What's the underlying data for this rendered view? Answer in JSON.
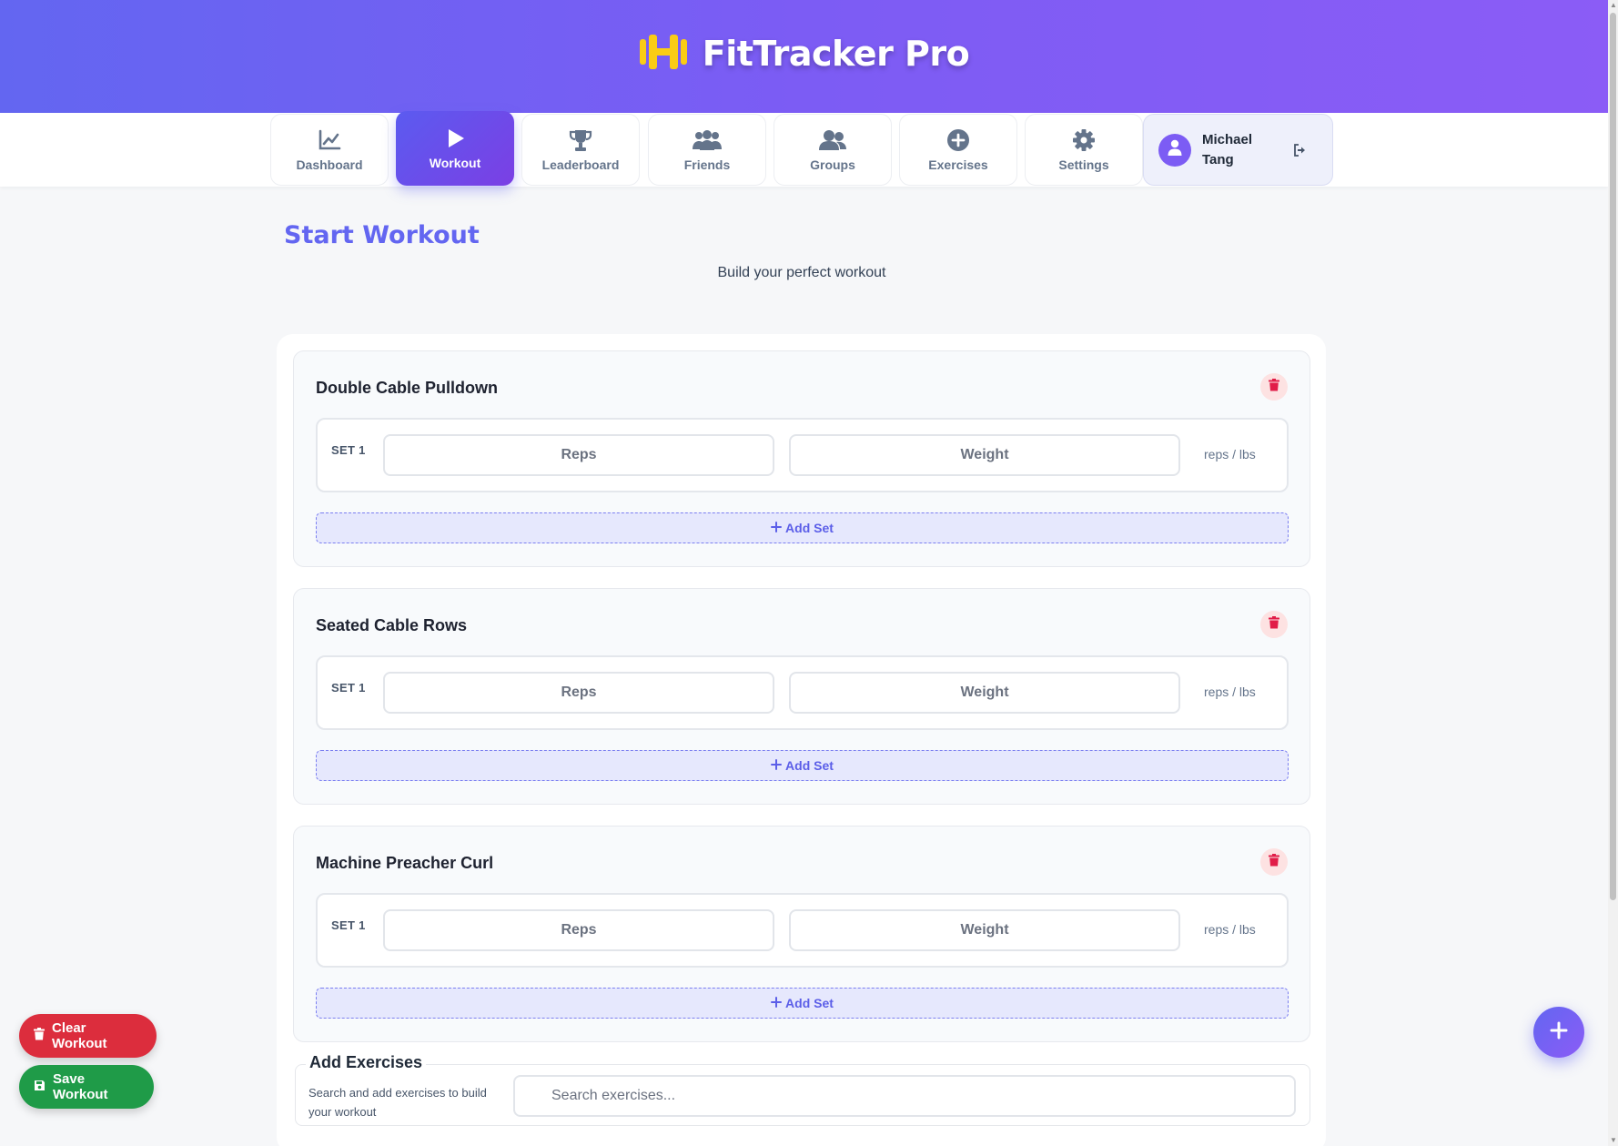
{
  "app": {
    "title": "FitTracker Pro",
    "logo_icon": "dumbbell-icon",
    "logo_color": "#facc15"
  },
  "colors": {
    "accent": "#6366f1",
    "accent_end": "#8b5cf6",
    "danger": "#dc2d3d",
    "success": "#1f9b48"
  },
  "nav": {
    "items": [
      {
        "label": "Dashboard",
        "icon": "chart-line-icon",
        "active": false
      },
      {
        "label": "Workout",
        "icon": "play-icon",
        "active": true
      },
      {
        "label": "Leaderboard",
        "icon": "trophy-icon",
        "active": false
      },
      {
        "label": "Friends",
        "icon": "users-icon",
        "active": false
      },
      {
        "label": "Groups",
        "icon": "user-group-icon",
        "active": false
      },
      {
        "label": "Exercises",
        "icon": "plus-circle-icon",
        "active": false
      },
      {
        "label": "Settings",
        "icon": "gear-icon",
        "active": false
      }
    ],
    "user": {
      "name": "Michael Tang",
      "avatar_icon": "user-icon",
      "logout_icon": "sign-out-icon"
    }
  },
  "page": {
    "title": "Start Workout",
    "subtitle": "Build your perfect workout"
  },
  "exercises": [
    {
      "name": "Double Cable Pulldown",
      "sets": [
        {
          "label": "SET 1",
          "reps_placeholder": "Reps",
          "weight_placeholder": "Weight",
          "unit": "reps / lbs"
        }
      ],
      "add_set_label": "Add Set"
    },
    {
      "name": "Seated Cable Rows",
      "sets": [
        {
          "label": "SET 1",
          "reps_placeholder": "Reps",
          "weight_placeholder": "Weight",
          "unit": "reps / lbs"
        }
      ],
      "add_set_label": "Add Set"
    },
    {
      "name": "Machine Preacher Curl",
      "sets": [
        {
          "label": "SET 1",
          "reps_placeholder": "Reps",
          "weight_placeholder": "Weight",
          "unit": "reps / lbs"
        }
      ],
      "add_set_label": "Add Set"
    }
  ],
  "add_exercises": {
    "title": "Add Exercises",
    "description": "Search and add exercises to build your workout",
    "search_placeholder": "Search exercises...",
    "search_value": ""
  },
  "actions": {
    "clear_label": "Clear Workout",
    "save_label": "Save Workout",
    "fab_icon": "plus-icon"
  }
}
